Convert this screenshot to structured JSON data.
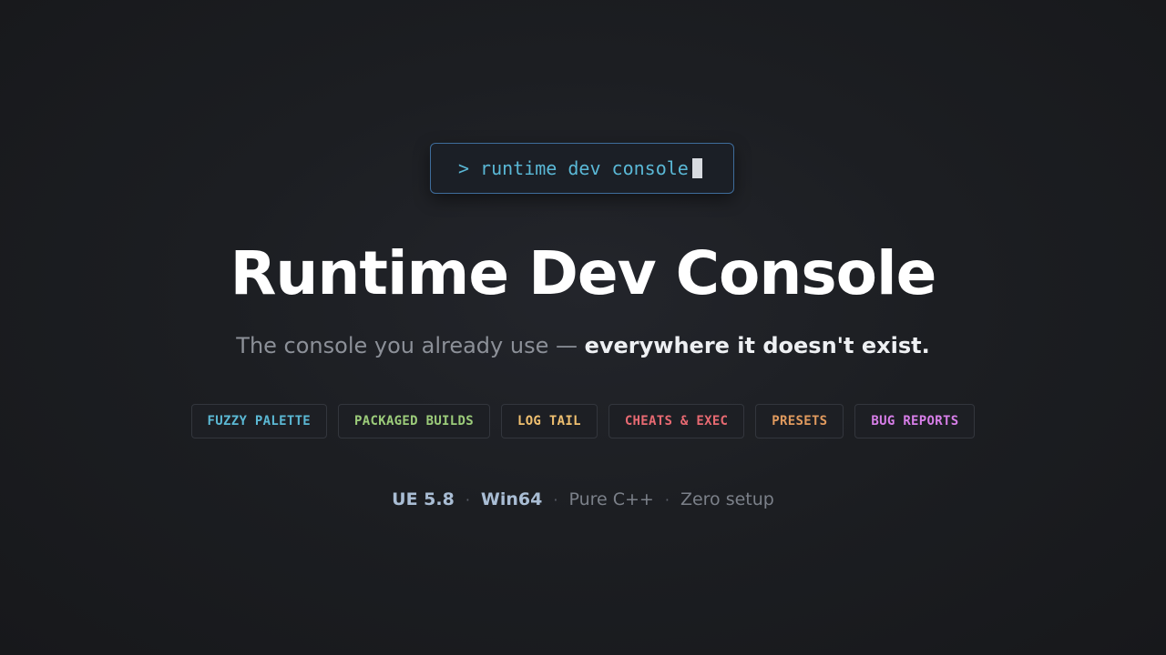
{
  "prompt": {
    "caret": ">",
    "command": "runtime dev console"
  },
  "title": "Runtime Dev Console",
  "subtitle": {
    "lead": "The console you already use — ",
    "emphasis": "everywhere it doesn't exist."
  },
  "chips": [
    {
      "label": "FUZZY PALETTE",
      "color": "#5bb8d4"
    },
    {
      "label": "PACKAGED BUILDS",
      "color": "#9ccc7a"
    },
    {
      "label": "LOG TAIL",
      "color": "#f0c070"
    },
    {
      "label": "CHEATS & EXEC",
      "color": "#e86a72"
    },
    {
      "label": "PRESETS",
      "color": "#e09a5e"
    },
    {
      "label": "BUG REPORTS",
      "color": "#d77ee8"
    }
  ],
  "footer": {
    "engine": "UE 5.8",
    "platform": "Win64",
    "language": "Pure C++",
    "setup": "Zero setup",
    "separator": "·"
  },
  "colors": {
    "accent": "#5ab8d6",
    "background": "#1c1e22"
  }
}
